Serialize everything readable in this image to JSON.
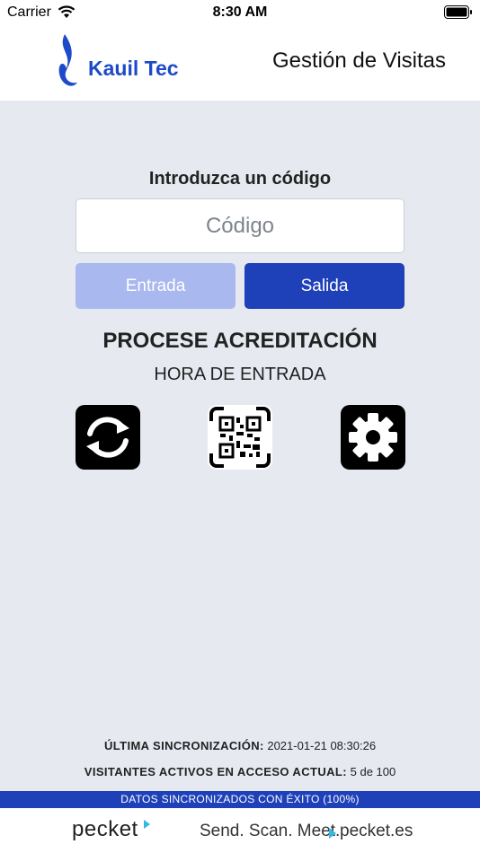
{
  "status_bar": {
    "carrier": "Carrier",
    "time": "8:30 AM"
  },
  "header": {
    "logo_text": "Kauil Tec",
    "title": "Gestión de Visitas",
    "brand_color": "#1d4ac9"
  },
  "form": {
    "prompt": "Introduzca un código",
    "code_placeholder": "Código",
    "code_value": "",
    "entrada_label": "Entrada",
    "salida_label": "Salida"
  },
  "status": {
    "main": "PROCESE ACREDITACIÓN",
    "sub": "HORA DE ENTRADA"
  },
  "actions": [
    {
      "icon": "sync-icon"
    },
    {
      "icon": "qr-code-icon"
    },
    {
      "icon": "gear-icon"
    }
  ],
  "info": {
    "last_sync_label": "ÚLTIMA SINCRONIZACIÓN:",
    "last_sync_value": "2021-01-21 08:30:26",
    "active_visitors_label": "VISITANTES ACTIVOS EN ACCESO ACTUAL:",
    "active_visitors_value": "5 de 100"
  },
  "banner": {
    "text": "DATOS SINCRONIZADOS CON ÉXITO (100%)",
    "color": "#1e40b8"
  },
  "footer": {
    "logo": "pecket",
    "tagline": "Send. Scan. Meet.",
    "site": "pecket.es",
    "accent": "#35b8e0"
  }
}
